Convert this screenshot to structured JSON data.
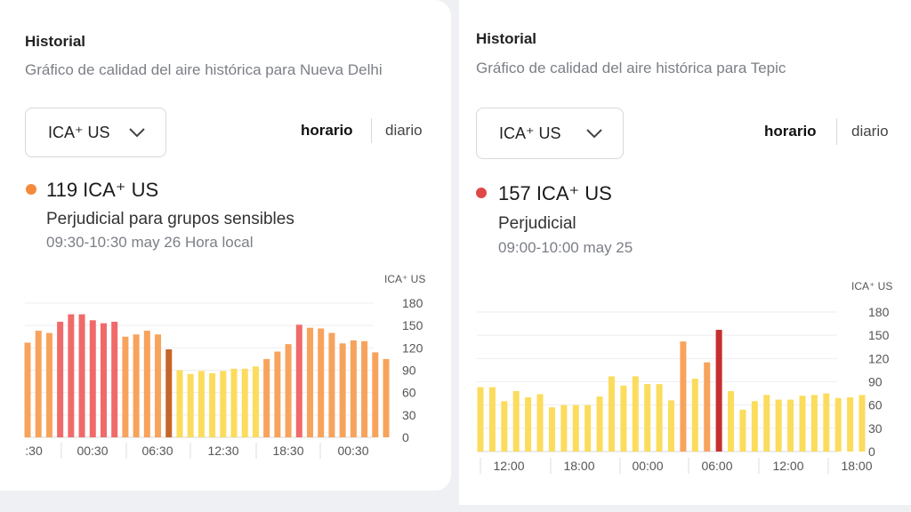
{
  "left": {
    "title": "Historial",
    "subtitle": "Gráfico de calidad del aire histórica para Nueva Delhi",
    "dropdown_value": "ICA⁺ US",
    "toggle_hourly": "horario",
    "toggle_daily": "diario",
    "current": {
      "value_text": "119 ICA⁺ US",
      "status": "Perjudicial para grupos sensibles",
      "time": "09:30-10:30 may 26 Hora local",
      "dot_color": "#f5893c"
    },
    "chart_unit": "ICA⁺ US"
  },
  "right": {
    "title": "Historial",
    "subtitle": "Gráfico de calidad del aire histórica para Tepic",
    "dropdown_value": "ICA⁺ US",
    "toggle_hourly": "horario",
    "toggle_daily": "diario",
    "current": {
      "value_text": "157 ICA⁺ US",
      "status": "Perjudicial",
      "time": "09:00-10:00 may 25",
      "dot_color": "#e04848"
    },
    "chart_unit": "ICA⁺ US"
  },
  "chart_data": [
    {
      "type": "bar",
      "title": "",
      "ylabel": "ICA⁺ US",
      "ylim": [
        0,
        180
      ],
      "yticks": [
        0,
        30,
        60,
        90,
        120,
        150,
        180
      ],
      "x_tick_labels": [
        ":30",
        "00:30",
        "06:30",
        "12:30",
        "18:30",
        "00:30"
      ],
      "values": [
        127,
        143,
        140,
        155,
        165,
        165,
        157,
        153,
        155,
        135,
        138,
        143,
        138,
        118,
        90,
        85,
        89,
        86,
        89,
        92,
        92,
        95,
        105,
        115,
        125,
        151,
        147,
        146,
        140,
        126,
        130,
        129,
        114,
        105
      ],
      "highlight_index": 13,
      "colors": {
        "unhealthy_sensitive": "#f7a35c",
        "unhealthy": "#f06a6a",
        "moderate": "#fbdc5c",
        "selected": "#c4652a"
      }
    },
    {
      "type": "bar",
      "title": "",
      "ylabel": "ICA⁺ US",
      "ylim": [
        0,
        180
      ],
      "yticks": [
        0,
        30,
        60,
        90,
        120,
        150,
        180
      ],
      "x_tick_labels": [
        "12:00",
        "18:00",
        "00:00",
        "06:00",
        "12:00",
        "18:00"
      ],
      "values": [
        83,
        83,
        65,
        78,
        70,
        74,
        57,
        60,
        60,
        60,
        71,
        97,
        85,
        97,
        87,
        87,
        66,
        142,
        94,
        115,
        157,
        78,
        54,
        65,
        73,
        67,
        67,
        72,
        73,
        75,
        69,
        70,
        73
      ],
      "highlight_index": 20,
      "colors": {
        "unhealthy_sensitive": "#f7a35c",
        "unhealthy": "#e25757",
        "moderate": "#fbdc5c",
        "selected": "#c62f2f"
      }
    }
  ]
}
